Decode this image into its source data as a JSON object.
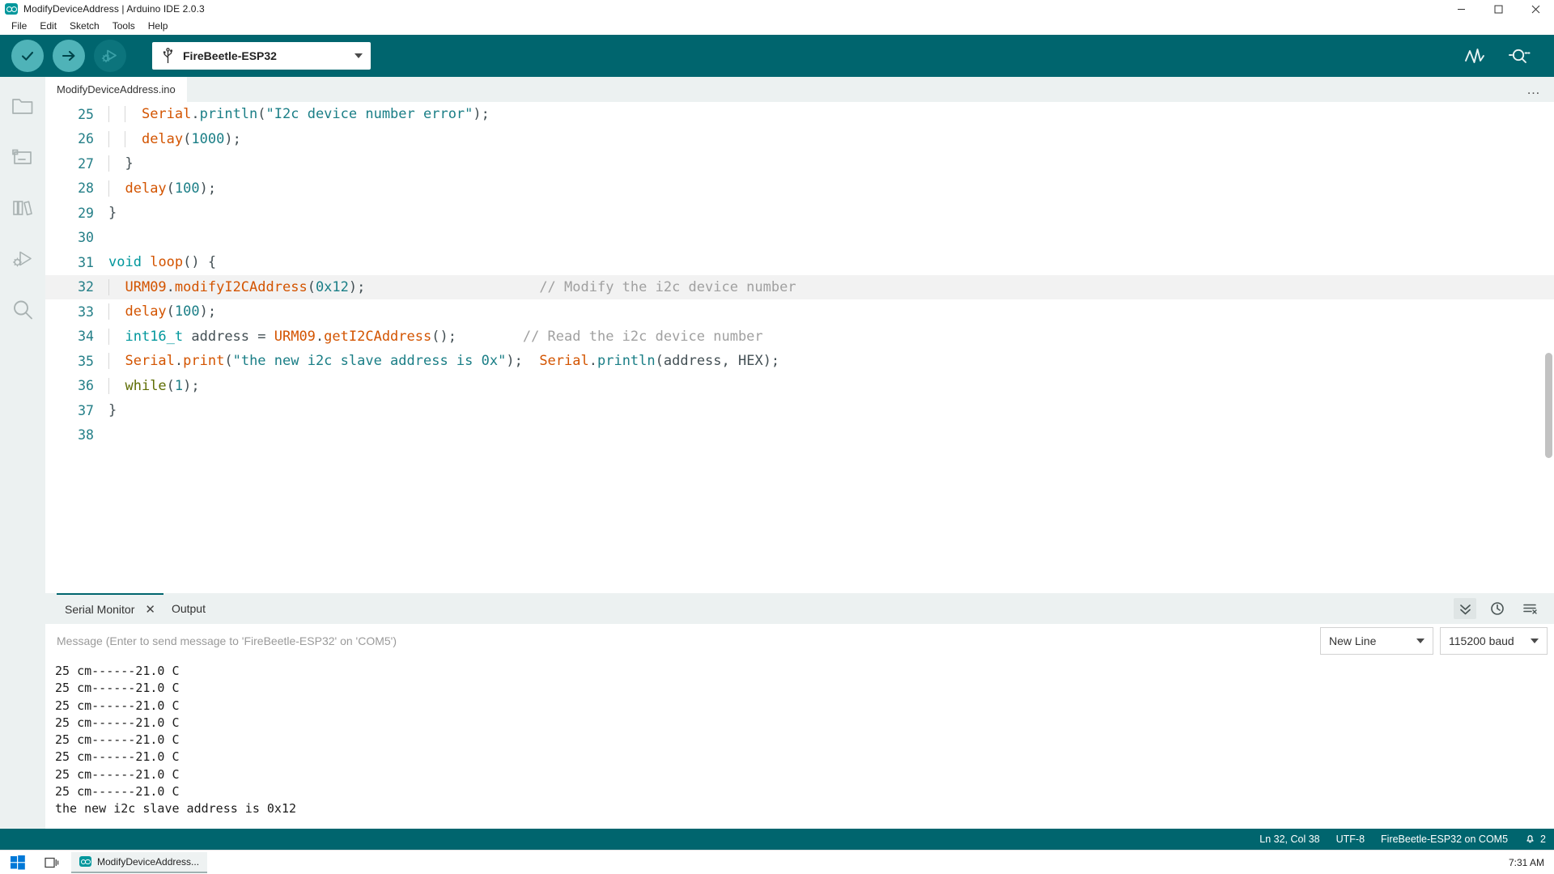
{
  "window": {
    "title": "ModifyDeviceAddress | Arduino IDE 2.0.3",
    "app_icon": "arduino-logo-icon",
    "minimize_label": "Minimize",
    "maximize_label": "Maximize",
    "close_label": "Close"
  },
  "menubar": {
    "items": [
      {
        "label": "File"
      },
      {
        "label": "Edit"
      },
      {
        "label": "Sketch"
      },
      {
        "label": "Tools"
      },
      {
        "label": "Help"
      }
    ]
  },
  "toolbar": {
    "verify_label": "Verify",
    "upload_label": "Upload",
    "debug_label": "Debug",
    "board_selector": {
      "icon": "usb-icon",
      "value": "FireBeetle-ESP32"
    },
    "serial_plotter_label": "Serial Plotter",
    "serial_monitor_label": "Serial Monitor",
    "accent_color": "#00656e",
    "button_color": "#4fb3b8"
  },
  "sidebar": {
    "items": [
      {
        "icon": "sketchbook-folder-icon",
        "label": "Sketchbook"
      },
      {
        "icon": "boards-manager-icon",
        "label": "Boards Manager"
      },
      {
        "icon": "library-manager-icon",
        "label": "Library Manager"
      },
      {
        "icon": "debug-icon",
        "label": "Debug"
      },
      {
        "icon": "search-icon",
        "label": "Search"
      }
    ]
  },
  "editor": {
    "tab_label": "ModifyDeviceAddress.ino",
    "more_actions": "…",
    "active_line": 32,
    "lines": [
      {
        "n": 25,
        "indent": 2,
        "tokens": [
          {
            "t": "    ",
            "c": "plain"
          },
          {
            "t": "Serial",
            "c": "fn"
          },
          {
            "t": ".",
            "c": "plain"
          },
          {
            "t": "println",
            "c": "meth"
          },
          {
            "t": "(",
            "c": "plain"
          },
          {
            "t": "\"I2c device number error\"",
            "c": "str"
          },
          {
            "t": ")",
            "c": "plain"
          },
          {
            "t": ";",
            "c": "plain"
          }
        ]
      },
      {
        "n": 26,
        "indent": 2,
        "tokens": [
          {
            "t": "    ",
            "c": "plain"
          },
          {
            "t": "delay",
            "c": "fn"
          },
          {
            "t": "(",
            "c": "plain"
          },
          {
            "t": "1000",
            "c": "num"
          },
          {
            "t": ");",
            "c": "plain"
          }
        ]
      },
      {
        "n": 27,
        "indent": 1,
        "tokens": [
          {
            "t": "  }",
            "c": "plain"
          }
        ]
      },
      {
        "n": 28,
        "indent": 1,
        "tokens": [
          {
            "t": "  ",
            "c": "plain"
          },
          {
            "t": "delay",
            "c": "fn"
          },
          {
            "t": "(",
            "c": "plain"
          },
          {
            "t": "100",
            "c": "num"
          },
          {
            "t": ");",
            "c": "plain"
          }
        ]
      },
      {
        "n": 29,
        "indent": 0,
        "tokens": [
          {
            "t": "}",
            "c": "plain"
          }
        ]
      },
      {
        "n": 30,
        "indent": 0,
        "tokens": [
          {
            "t": "",
            "c": "plain"
          }
        ]
      },
      {
        "n": 31,
        "indent": 0,
        "tokens": [
          {
            "t": "void",
            "c": "kw"
          },
          {
            "t": " ",
            "c": "plain"
          },
          {
            "t": "loop",
            "c": "fn"
          },
          {
            "t": "() {",
            "c": "plain"
          }
        ]
      },
      {
        "n": 32,
        "indent": 1,
        "tokens": [
          {
            "t": "  ",
            "c": "plain"
          },
          {
            "t": "URM09",
            "c": "fn"
          },
          {
            "t": ".",
            "c": "plain"
          },
          {
            "t": "modifyI2CAddress",
            "c": "fn"
          },
          {
            "t": "(",
            "c": "plain"
          },
          {
            "t": "0x12",
            "c": "num"
          },
          {
            "t": ");",
            "c": "plain"
          },
          {
            "t": "                     ",
            "c": "plain"
          },
          {
            "t": "// Modify the i2c device number",
            "c": "cmt"
          }
        ]
      },
      {
        "n": 33,
        "indent": 1,
        "tokens": [
          {
            "t": "  ",
            "c": "plain"
          },
          {
            "t": "delay",
            "c": "fn"
          },
          {
            "t": "(",
            "c": "plain"
          },
          {
            "t": "100",
            "c": "num"
          },
          {
            "t": ");",
            "c": "plain"
          }
        ]
      },
      {
        "n": 34,
        "indent": 1,
        "tokens": [
          {
            "t": "  ",
            "c": "plain"
          },
          {
            "t": "int16_t",
            "c": "kw"
          },
          {
            "t": " address = ",
            "c": "plain"
          },
          {
            "t": "URM09",
            "c": "fn"
          },
          {
            "t": ".",
            "c": "plain"
          },
          {
            "t": "getI2CAddress",
            "c": "fn"
          },
          {
            "t": "();",
            "c": "plain"
          },
          {
            "t": "        ",
            "c": "plain"
          },
          {
            "t": "// Read the i2c device number",
            "c": "cmt"
          }
        ]
      },
      {
        "n": 35,
        "indent": 1,
        "tokens": [
          {
            "t": "  ",
            "c": "plain"
          },
          {
            "t": "Serial",
            "c": "fn"
          },
          {
            "t": ".",
            "c": "plain"
          },
          {
            "t": "print",
            "c": "fn"
          },
          {
            "t": "(",
            "c": "plain"
          },
          {
            "t": "\"the new i2c slave address is 0x\"",
            "c": "str"
          },
          {
            "t": ");  ",
            "c": "plain"
          },
          {
            "t": "Serial",
            "c": "fn"
          },
          {
            "t": ".",
            "c": "plain"
          },
          {
            "t": "println",
            "c": "meth"
          },
          {
            "t": "(address, HEX);",
            "c": "plain"
          }
        ]
      },
      {
        "n": 36,
        "indent": 1,
        "tokens": [
          {
            "t": "  ",
            "c": "plain"
          },
          {
            "t": "while",
            "c": "kw2"
          },
          {
            "t": "(",
            "c": "plain"
          },
          {
            "t": "1",
            "c": "num"
          },
          {
            "t": ");",
            "c": "plain"
          }
        ]
      },
      {
        "n": 37,
        "indent": 0,
        "tokens": [
          {
            "t": "}",
            "c": "plain"
          }
        ]
      },
      {
        "n": 38,
        "indent": 0,
        "tokens": [
          {
            "t": "",
            "c": "plain"
          }
        ]
      }
    ]
  },
  "panel": {
    "tabs": [
      {
        "label": "Serial Monitor",
        "active": true,
        "closable": true
      },
      {
        "label": "Output",
        "active": false,
        "closable": false
      }
    ],
    "close_icon": "close-icon",
    "actions": [
      {
        "icon": "autoscroll-icon",
        "label": "Autoscroll",
        "active": true
      },
      {
        "icon": "timestamp-clock-icon",
        "label": "Show timestamp",
        "active": false
      },
      {
        "icon": "clear-output-icon",
        "label": "Clear output",
        "active": false
      }
    ],
    "message_placeholder": "Message (Enter to send message to 'FireBeetle-ESP32' on 'COM5')",
    "message_value": "",
    "line_ending": {
      "value": "New Line",
      "icon": "chevron-down-icon"
    },
    "baud_rate": {
      "value": "115200 baud",
      "icon": "chevron-down-icon"
    },
    "console_lines": [
      "25 cm------21.0 C",
      "25 cm------21.0 C",
      "25 cm------21.0 C",
      "25 cm------21.0 C",
      "25 cm------21.0 C",
      "25 cm------21.0 C",
      "25 cm------21.0 C",
      "25 cm------21.0 C",
      "the new i2c slave address is 0x12"
    ]
  },
  "statusbar": {
    "cursor": "Ln 32, Col 38",
    "encoding": "UTF-8",
    "board": "FireBeetle-ESP32 on COM5",
    "notifications_icon": "bell-notification-icon",
    "notifications_count": "2"
  },
  "taskbar": {
    "start_icon": "windows-start-icon",
    "search_icon": "task-view-icon",
    "app": {
      "icon": "arduino-logo-icon",
      "label": "ModifyDeviceAddress..."
    },
    "clock": "7:31 AM"
  }
}
